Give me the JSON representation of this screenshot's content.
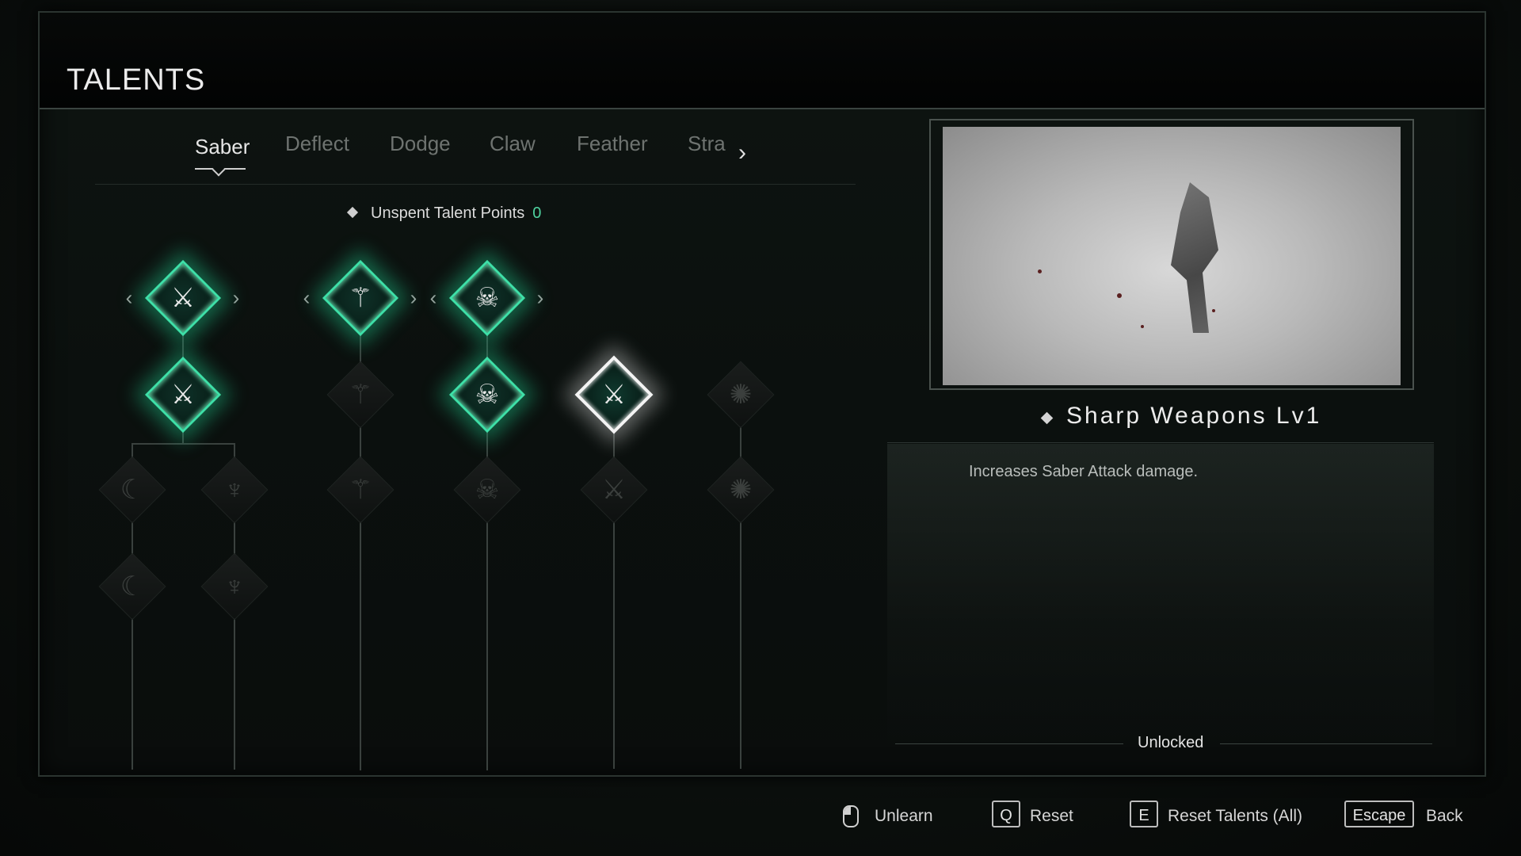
{
  "header": {
    "title": "TALENTS"
  },
  "tabs": [
    {
      "label": "Saber",
      "active": true
    },
    {
      "label": "Deflect"
    },
    {
      "label": "Dodge"
    },
    {
      "label": "Claw"
    },
    {
      "label": "Feather"
    },
    {
      "label": "Stra"
    }
  ],
  "talent_points": {
    "label": "Unspent Talent Points",
    "value": "0"
  },
  "tree": {
    "nodes": [
      {
        "id": "saber-1a",
        "state": "unlocked",
        "icon": "saber-slash-icon"
      },
      {
        "id": "saber-1b",
        "state": "unlocked",
        "icon": "saber-slash-icon"
      },
      {
        "id": "saber-2a",
        "state": "locked",
        "icon": "cloak-icon"
      },
      {
        "id": "saber-2b",
        "state": "locked",
        "icon": "horned-figure-icon"
      },
      {
        "id": "saber-3a",
        "state": "locked",
        "icon": "cloak-icon"
      },
      {
        "id": "saber-3b",
        "state": "locked",
        "icon": "horned-figure-icon"
      },
      {
        "id": "claw-1",
        "state": "unlocked",
        "icon": "claw-strike-icon"
      },
      {
        "id": "claw-2",
        "state": "locked",
        "icon": "claw-strike-icon"
      },
      {
        "id": "claw-3",
        "state": "locked",
        "icon": "claw-strike-icon"
      },
      {
        "id": "skull-1",
        "state": "unlocked",
        "icon": "skull-dagger-icon"
      },
      {
        "id": "skull-2",
        "state": "unlocked",
        "icon": "skull-dagger-icon"
      },
      {
        "id": "skull-3",
        "state": "locked",
        "icon": "skull-dagger-icon"
      },
      {
        "id": "sharp-weapons",
        "state": "selected",
        "icon": "sword-icon"
      },
      {
        "id": "sword-2",
        "state": "locked",
        "icon": "sword-icon"
      },
      {
        "id": "burst-1",
        "state": "locked",
        "icon": "burst-icon"
      },
      {
        "id": "burst-2",
        "state": "locked",
        "icon": "burst-icon"
      }
    ]
  },
  "detail": {
    "title": "Sharp Weapons Lv1",
    "description": "Increases Saber Attack damage.",
    "status": "Unlocked"
  },
  "footer": {
    "unlearn": {
      "key": "mouse-icon",
      "label": "Unlearn"
    },
    "reset": {
      "key": "Q",
      "label": "Reset"
    },
    "reset_all": {
      "key": "E",
      "label": "Reset Talents (All)"
    },
    "back": {
      "key": "Escape",
      "label": "Back"
    }
  },
  "colors": {
    "accent": "#3ee0a8",
    "points_value": "#4fd3a0",
    "background": "#0b0f0d"
  }
}
